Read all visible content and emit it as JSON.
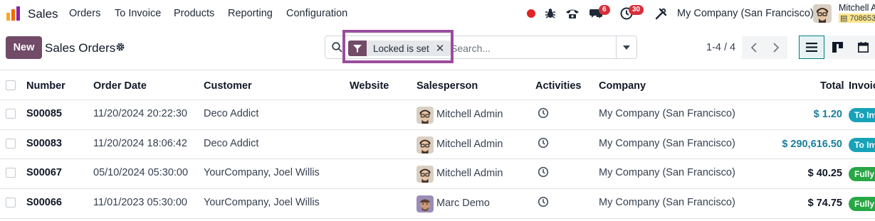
{
  "navbar": {
    "app_name": "Sales",
    "menu": [
      "Orders",
      "To Invoice",
      "Products",
      "Reporting",
      "Configuration"
    ],
    "messages_count": "6",
    "activities_count": "30",
    "company": "My Company (San Francisco)",
    "user_name": "Mitchell Admin",
    "user_db": "708653"
  },
  "control": {
    "new_label": "New",
    "title": "Sales Orders",
    "facet_label": "Locked is set",
    "search_placeholder": "Search...",
    "pager": "1-4 / 4"
  },
  "table": {
    "headers": {
      "number": "Number",
      "order_date": "Order Date",
      "customer": "Customer",
      "website": "Website",
      "salesperson": "Salesperson",
      "activities": "Activities",
      "company": "Company",
      "total": "Total",
      "invoice_status": "Invoice Status"
    },
    "rows": [
      {
        "number": "S00085",
        "date": "11/20/2024 20:22:30",
        "customer": "Deco Addict",
        "salesperson": "Mitchell Admin",
        "company": "My Company (San Francisco)",
        "total": "$ 1.20",
        "status": "To Invoice"
      },
      {
        "number": "S00083",
        "date": "11/20/2024 18:06:42",
        "customer": "Deco Addict",
        "salesperson": "Mitchell Admin",
        "company": "My Company (San Francisco)",
        "total": "$ 290,616.50",
        "status": "To Invoice"
      },
      {
        "number": "S00067",
        "date": "05/10/2024 05:30:00",
        "customer": "YourCompany, Joel Willis",
        "salesperson": "Mitchell Admin",
        "company": "My Company (San Francisco)",
        "total": "$ 40.25",
        "status": "Fully Invoiced"
      },
      {
        "number": "S00066",
        "date": "11/01/2023 05:30:00",
        "customer": "YourCompany, Joel Willis",
        "salesperson": "Marc Demo",
        "company": "My Company (San Francisco)",
        "total": "$ 74.75",
        "status": "Fully Invoiced"
      }
    ]
  },
  "colors": {
    "brand": "#714b67",
    "highlight": "#9b4d9e",
    "total_teal": "#1a7f9c",
    "to_invoice": "#17a2b8",
    "fully_invoiced": "#28a745",
    "badge": "#d8303b"
  }
}
